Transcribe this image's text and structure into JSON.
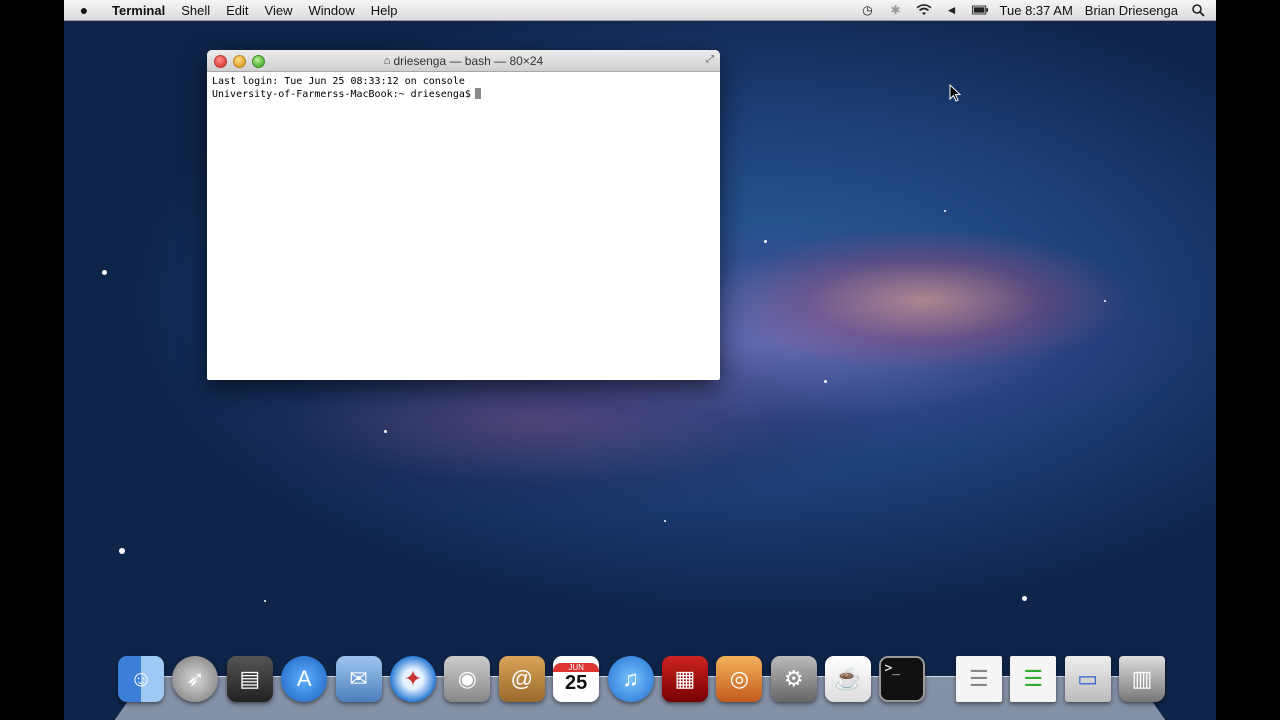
{
  "menubar": {
    "apple": "",
    "app": "Terminal",
    "menus": [
      "Shell",
      "Edit",
      "View",
      "Window",
      "Help"
    ],
    "clock": "Tue 8:37 AM",
    "user": "Brian Driesenga",
    "status_icons": [
      "time-machine-icon",
      "bluetooth-icon",
      "wifi-icon",
      "volume-icon",
      "battery-icon",
      "spotlight-icon"
    ]
  },
  "terminal": {
    "title": "driesenga — bash — 80×24",
    "lines": [
      "Last login: Tue Jun 25 08:33:12 on console",
      "University-of-Farmerss-MacBook:~ driesenga$"
    ]
  },
  "dock": {
    "calendar_day": "25",
    "calendar_month": "JUN",
    "apps": [
      "finder-icon",
      "launchpad-icon",
      "mission-control-icon",
      "app-store-icon",
      "mail-icon",
      "safari-icon",
      "facetime-icon",
      "address-book-icon",
      "ical-icon",
      "itunes-icon",
      "photo-booth-icon",
      "iphoto-icon",
      "system-preferences-icon",
      "java-icon",
      "terminal-icon"
    ],
    "docs": [
      "document-icon",
      "document-2-icon",
      "window-icon",
      "trash-icon"
    ]
  }
}
